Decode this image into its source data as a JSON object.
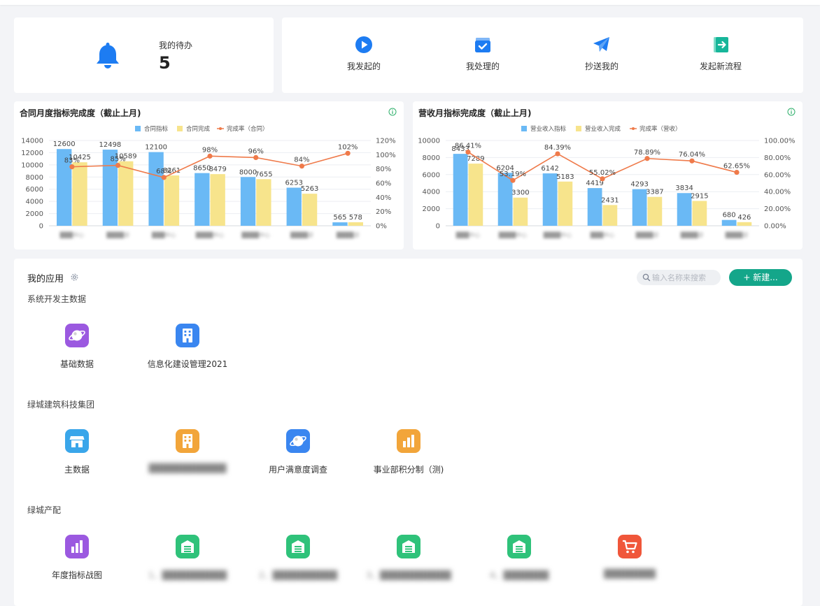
{
  "todo": {
    "label": "我的待办",
    "count": "5"
  },
  "actions": [
    {
      "label": "我发起的",
      "icon": "play-circle-icon",
      "color": "#1d7cf2"
    },
    {
      "label": "我处理的",
      "icon": "checkbox-tray-icon",
      "color": "#1d7cf2"
    },
    {
      "label": "抄送我的",
      "icon": "paper-plane-icon",
      "color": "#1d7cf2"
    },
    {
      "label": "发起新流程",
      "icon": "exit-door-icon",
      "color": "#17b69a"
    }
  ],
  "charts": [
    {
      "title": "合同月度指标完成度（截止上月)",
      "chart_data": {
        "type": "bar",
        "legend": [
          "合同指标",
          "合同完成",
          "完成率（合同）"
        ],
        "categories": [
          "███中心",
          "████部",
          "███中心",
          "████中心",
          "████中心",
          "████部",
          "████部"
        ],
        "series": [
          {
            "name": "合同指标",
            "values": [
              12600,
              12498,
              12100,
              8650,
              8000,
              6253,
              565
            ],
            "color": "#6ab9f5"
          },
          {
            "name": "合同完成",
            "values": [
              10425,
              10589,
              8261,
              8479,
              7655,
              5263,
              578
            ],
            "color": "#f7e48c"
          },
          {
            "name": "完成率（合同）",
            "values": [
              83,
              85,
              68,
              98,
              96,
              84,
              102
            ],
            "value_labels": [
              "83%",
              "85%",
              "68%",
              "98%",
              "96%",
              "84%",
              "102%"
            ],
            "color": "#ef7a4a",
            "axis": "right",
            "type": "line"
          }
        ],
        "left_ticks": [
          "14000",
          "12000",
          "10000",
          "8000",
          "6000",
          "4000",
          "2000",
          "0"
        ],
        "right_ticks": [
          "120%",
          "100%",
          "80%",
          "60%",
          "40%",
          "20%",
          "0%"
        ],
        "ylim_left": [
          0,
          14000
        ],
        "ylim_right": [
          0,
          120
        ]
      }
    },
    {
      "title": "营收月指标完成度（截止上月)",
      "chart_data": {
        "type": "bar",
        "legend": [
          "营业收入指标",
          "营业收入完成",
          "完成率（营收）"
        ],
        "categories": [
          "███中心",
          "████中心",
          "████中心",
          "███中心",
          "████部",
          "████部",
          "████部"
        ],
        "series": [
          {
            "name": "营业收入指标",
            "values": [
              8433,
              6204,
              6142,
              4419,
              4293,
              3834,
              680
            ],
            "color": "#6ab9f5"
          },
          {
            "name": "营业收入完成",
            "values": [
              7289,
              3300,
              5183,
              2431,
              3387,
              2915,
              426
            ],
            "color": "#f7e48c"
          },
          {
            "name": "完成率（营收）",
            "values": [
              86.41,
              53.19,
              84.39,
              55.02,
              78.89,
              76.04,
              62.65
            ],
            "value_labels": [
              "86.41%",
              "53.19%",
              "84.39%",
              "55.02%",
              "78.89%",
              "76.04%",
              "62.65%"
            ],
            "color": "#ef7a4a",
            "axis": "right",
            "type": "line"
          }
        ],
        "left_ticks": [
          "10000",
          "8000",
          "6000",
          "4000",
          "2000",
          "0"
        ],
        "right_ticks": [
          "100.00%",
          "80.00%",
          "60.00%",
          "40.00%",
          "20.00%",
          "0.00%"
        ],
        "ylim_left": [
          0,
          10000
        ],
        "ylim_right": [
          0,
          100
        ]
      }
    }
  ],
  "apps": {
    "title": "我的应用",
    "search_placeholder": "输入名称来搜索",
    "new_label": "+ 新建...",
    "groups": [
      {
        "title": "系统开发主数据",
        "items": [
          {
            "label": "基础数据",
            "icon": "planet-icon",
            "color": "#9b59e0"
          },
          {
            "label": "信息化建设管理2021",
            "icon": "building-icon",
            "color": "#3a86f0"
          }
        ]
      },
      {
        "title": "绿城建筑科技集团",
        "items": [
          {
            "label": "主数据",
            "icon": "shop-icon",
            "color": "#3aa6ea"
          },
          {
            "label": "████████████",
            "icon": "building-icon",
            "color": "#f2a53a",
            "blurred": true
          },
          {
            "label": "用户满意度调查",
            "icon": "planet-icon",
            "color": "#3a86f0"
          },
          {
            "label": "事业部积分制（测)",
            "icon": "bar-chart-icon",
            "color": "#f2a53a"
          }
        ]
      },
      {
        "title": "绿城产配",
        "items": [
          {
            "label": "年度指标战图",
            "icon": "bar-chart-icon",
            "color": "#9b59e0"
          },
          {
            "label": "1、██████████",
            "icon": "warehouse-icon",
            "color": "#2fc27a",
            "blurred": true
          },
          {
            "label": "2、██████████",
            "icon": "warehouse-icon",
            "color": "#2fc27a",
            "blurred": true
          },
          {
            "label": "3、███████████",
            "icon": "warehouse-icon",
            "color": "#2fc27a",
            "blurred": true
          },
          {
            "label": "4、███████",
            "icon": "warehouse-icon",
            "color": "#2fc27a",
            "blurred": true
          },
          {
            "label": "████████",
            "icon": "cart-icon",
            "color": "#f0563a",
            "blurred": true
          }
        ]
      }
    ]
  }
}
